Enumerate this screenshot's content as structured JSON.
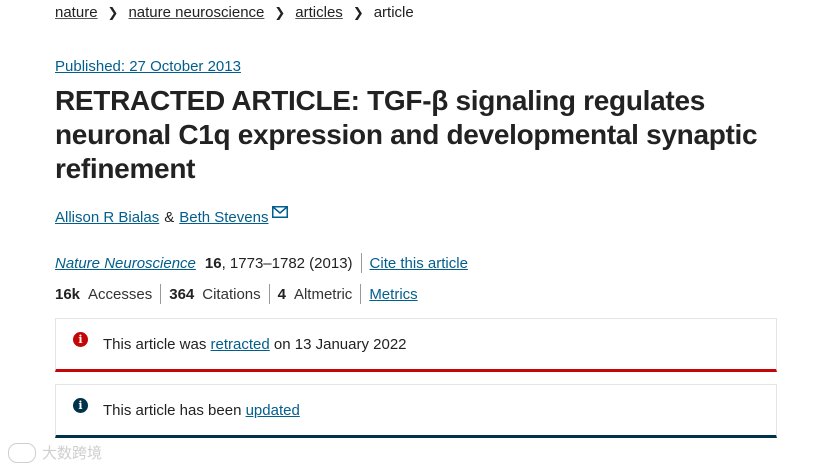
{
  "breadcrumb": {
    "items": [
      "nature",
      "nature neuroscience",
      "articles"
    ],
    "current": "article"
  },
  "published": "Published: 27 October 2013",
  "title": "RETRACTED ARTICLE: TGF-β signaling regulates neuronal C1q expression and developmental synaptic refinement",
  "authors": {
    "first": "Allison R Bialas",
    "and": "&",
    "second": "Beth Stevens"
  },
  "citation": {
    "journal": "Nature Neuroscience",
    "volume": "16",
    "pages_year": ", 1773–1782 (2013)",
    "cite_link": "Cite this article"
  },
  "metrics": {
    "accesses_value": "16k",
    "accesses_label": "Accesses",
    "citations_value": "364",
    "citations_label": "Citations",
    "altmetric_value": "4",
    "altmetric_label": "Altmetric",
    "metrics_link": "Metrics"
  },
  "notices": {
    "retracted": {
      "prefix": "This article was ",
      "link": "retracted",
      "suffix": " on 13 January 2022",
      "color": "#c40606"
    },
    "updated": {
      "prefix": "This article has been ",
      "link": "updated",
      "color": "#01324b"
    }
  },
  "watermark": "大数跨境",
  "colors": {
    "link": "#025e8d"
  }
}
